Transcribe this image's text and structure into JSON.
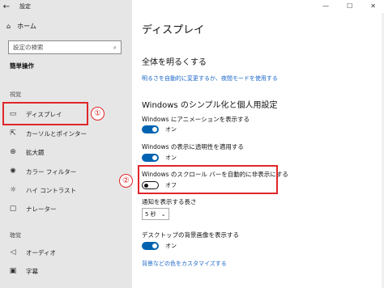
{
  "window": {
    "title": "設定",
    "back": "←",
    "minimize": "—",
    "maximize": "☐",
    "close": "✕"
  },
  "sidebar": {
    "home": "ホーム",
    "search_placeholder": "設定の検索",
    "section_title": "簡単操作",
    "group_vision": "視覚",
    "items": [
      {
        "label": "ディスプレイ",
        "icon": "display-icon"
      },
      {
        "label": "カーソルとポインター",
        "icon": "pointer-icon"
      },
      {
        "label": "拡大鏡",
        "icon": "magnifier-icon"
      },
      {
        "label": "カラー フィルター",
        "icon": "color-filter-icon"
      },
      {
        "label": "ハイ コントラスト",
        "icon": "high-contrast-icon"
      },
      {
        "label": "ナレーター",
        "icon": "narrator-icon"
      }
    ],
    "group_hearing": "聴覚",
    "hearing_items": [
      {
        "label": "オーディオ",
        "icon": "audio-icon"
      },
      {
        "label": "字幕",
        "icon": "caption-icon"
      }
    ]
  },
  "main": {
    "title": "ディスプレイ",
    "brightness_heading": "全体を明るくする",
    "brightness_link": "明るさを自動的に変更するか、夜間モードを使用する",
    "simplify_heading": "Windows のシンプル化と個人用設定",
    "settings": [
      {
        "label": "Windows にアニメーションを表示する",
        "state": "オン",
        "on": true
      },
      {
        "label": "Windows の表示に透明性を適用する",
        "state": "オン",
        "on": true
      },
      {
        "label": "Windows のスクロール バーを自動的に非表示にする",
        "state": "オフ",
        "on": false
      }
    ],
    "notify_label": "通知を表示する長さ",
    "notify_value": "5 秒",
    "desktop_bg_label": "デスクトップの背景画像を表示する",
    "desktop_bg_state": "オン",
    "personalize_link": "背景などの色をカスタマイズする"
  },
  "annotations": {
    "badge1": "①",
    "badge2": "②"
  },
  "colors": {
    "accent": "#0063b1",
    "highlight": "#e0262a",
    "link": "#1a66c9"
  }
}
